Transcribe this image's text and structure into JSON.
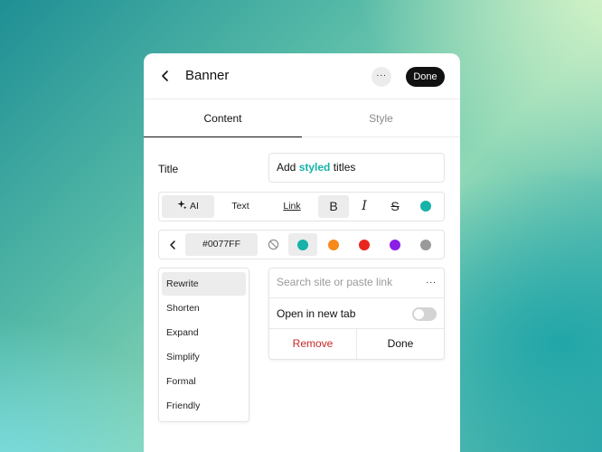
{
  "header": {
    "title": "Banner",
    "more_icon": "more-horizontal-icon",
    "more_label": "···",
    "done_label": "Done"
  },
  "tabs": [
    {
      "label": "Content"
    },
    {
      "label": "Style"
    }
  ],
  "title_field": {
    "label": "Title",
    "value_before": "Add ",
    "value_highlight": "styled",
    "value_after": " titles",
    "highlight_color": "#17b2a8"
  },
  "toolbar": {
    "ai_label": "AI",
    "ai_icon": "sparkle-icon",
    "text_label": "Text",
    "link_label": "Link",
    "bold_glyph": "B",
    "italic_glyph": "I",
    "strike_glyph": "S",
    "color_dot": "#17b2a8"
  },
  "color_bar": {
    "hex_value": "#0077FF",
    "swatches": [
      "none",
      "#17b2a8",
      "#f78a1a",
      "#e8261e",
      "#8a1fe6",
      "#9a9a9a"
    ]
  },
  "ai_menu": {
    "items": [
      {
        "label": "Rewrite"
      },
      {
        "label": "Shorten"
      },
      {
        "label": "Expand"
      },
      {
        "label": "Simplify"
      },
      {
        "label": "Formal"
      },
      {
        "label": "Friendly"
      }
    ]
  },
  "link_popover": {
    "search_placeholder": "Search site or paste link",
    "more_label": "···",
    "new_tab_label": "Open in new tab",
    "new_tab_enabled": false,
    "remove_label": "Remove",
    "done_label": "Done"
  }
}
